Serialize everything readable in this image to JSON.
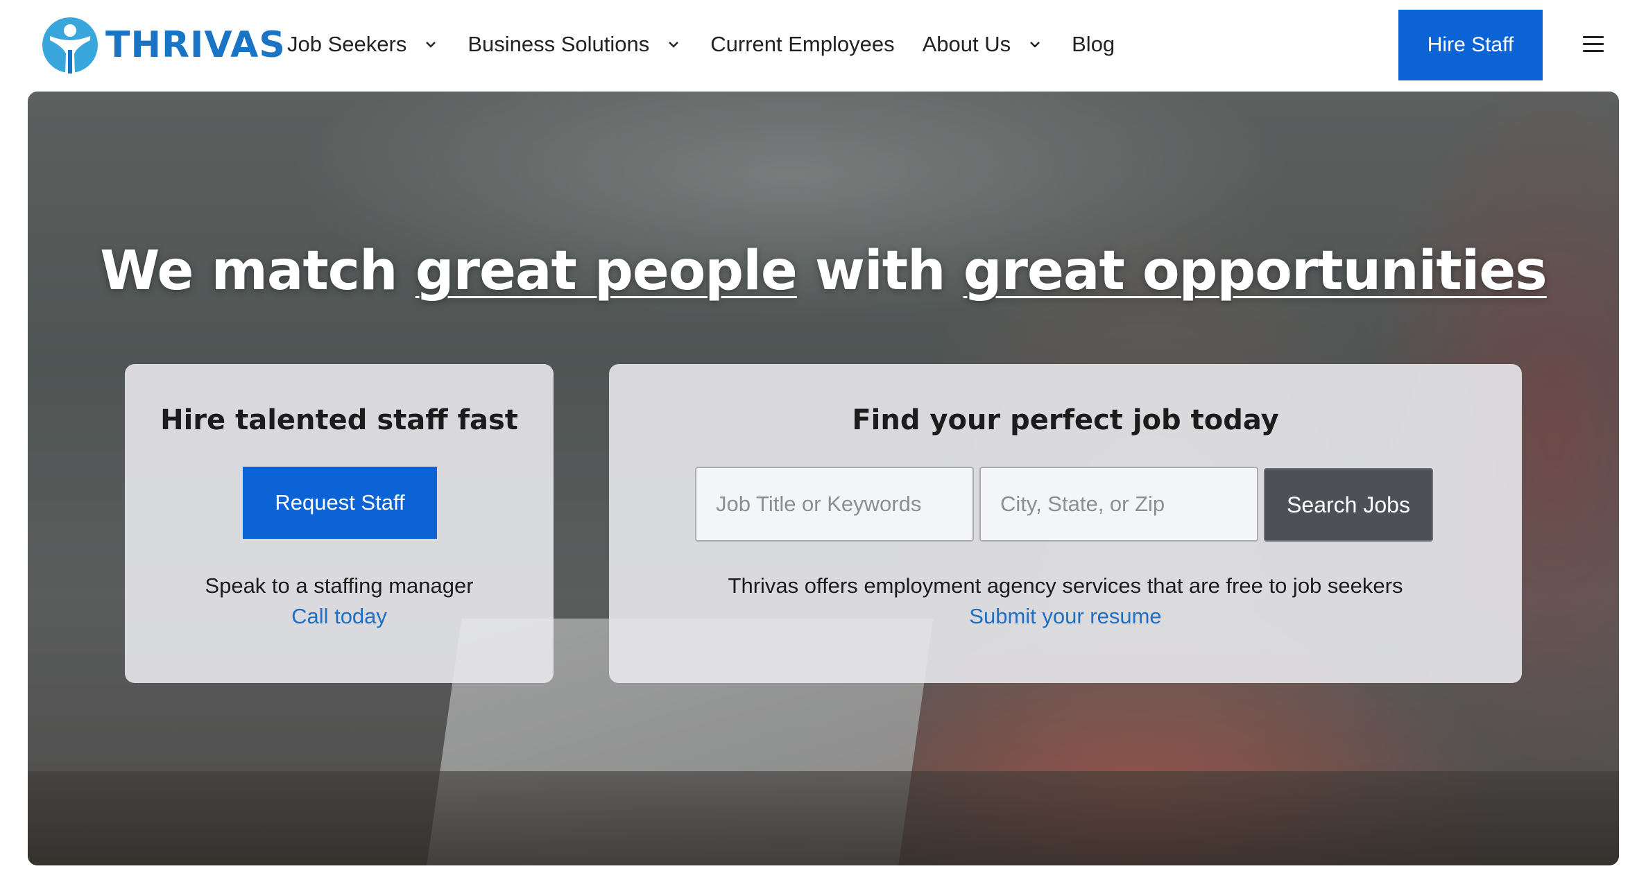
{
  "brand": {
    "name": "THRIVAS",
    "logo_icon": "person-figure-icon",
    "accent_color": "#1a74c6",
    "primary_button_color": "#0b63d6"
  },
  "nav": {
    "items": [
      {
        "label": "Job Seekers",
        "has_dropdown": true
      },
      {
        "label": "Business Solutions",
        "has_dropdown": true
      },
      {
        "label": "Current Employees",
        "has_dropdown": false
      },
      {
        "label": "About Us",
        "has_dropdown": true
      },
      {
        "label": "Blog",
        "has_dropdown": false
      }
    ],
    "hire_staff_label": "Hire Staff",
    "menu_icon": "hamburger-menu-icon"
  },
  "hero": {
    "headline_part1": "We match ",
    "headline_link1": "great people",
    "headline_part2": " with ",
    "headline_link2": "great opportunities"
  },
  "hire_card": {
    "title": "Hire talented staff fast",
    "button_label": "Request Staff",
    "text": "Speak to a staffing manager",
    "link": "Call today"
  },
  "job_card": {
    "title": "Find your perfect job today",
    "keywords_placeholder": "Job Title or Keywords",
    "location_placeholder": "City, State, or Zip",
    "search_button_label": "Search Jobs",
    "text": "Thrivas offers employment agency services that are free to job seekers",
    "link": "Submit your resume"
  }
}
